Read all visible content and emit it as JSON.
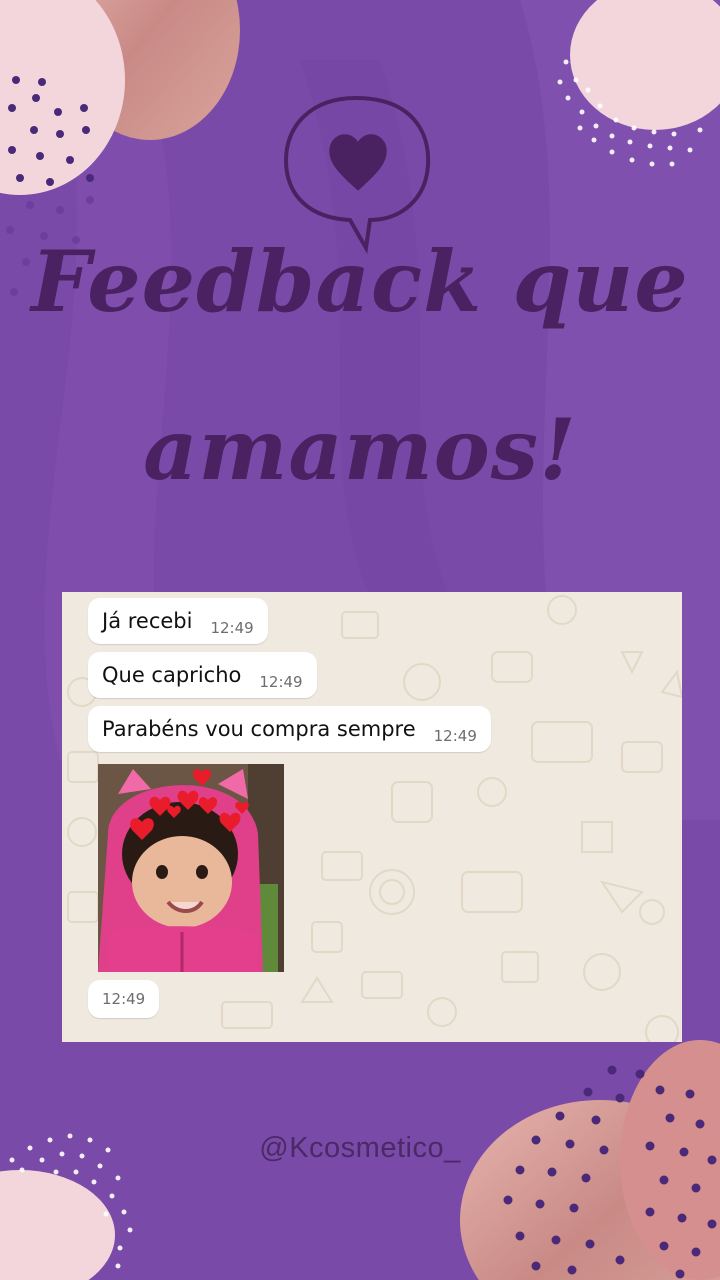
{
  "post": {
    "title_line1": "Feedback que",
    "title_line2": "amamos!",
    "handle": "@Kcosmetico_",
    "icon": "heart-speech-bubble-icon"
  },
  "chat": {
    "messages": [
      {
        "text": "Já recebi",
        "time": "12:49"
      },
      {
        "text": "Que capricho",
        "time": "12:49"
      },
      {
        "text": "Parabéns vou compra sempre",
        "time": "12:49"
      }
    ],
    "photo_time": "12:49"
  },
  "colors": {
    "background": "#7a4aa8",
    "headline": "#4a2262",
    "blob_pink": "#f2d6dc",
    "rose_gold": "#c9898a",
    "chat_bg": "#efe9df"
  }
}
